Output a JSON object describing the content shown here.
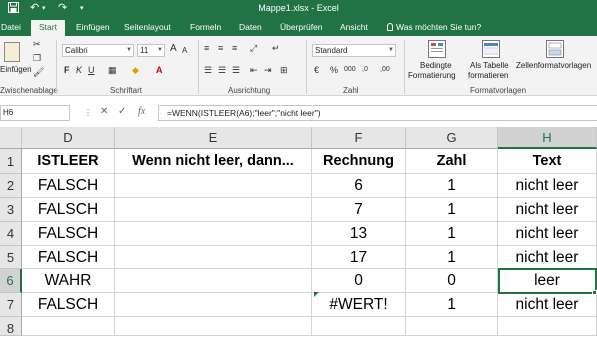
{
  "window": {
    "title": "Mappe1.xlsx - Excel",
    "save_icon": "save-icon",
    "undo_icon": "undo-icon",
    "redo_icon": "redo-icon",
    "qa_dropdown_icon": "dropdown-icon"
  },
  "ribbon_tabs": [
    "Datei",
    "Start",
    "Einfügen",
    "Seitenlayout",
    "Formeln",
    "Daten",
    "Überprüfen",
    "Ansicht"
  ],
  "active_tab": "Start",
  "tell_me": "Was möchten Sie tun?",
  "clipboard": {
    "paste_label": "Einfügen",
    "group_label": "Zwischenablage"
  },
  "font": {
    "name": "Calibri",
    "size": "11",
    "group_label": "Schriftart",
    "bold": "F",
    "italic": "K",
    "underline": "U",
    "grow": "A",
    "shrink": "A"
  },
  "alignment": {
    "group_label": "Ausrichtung"
  },
  "number": {
    "format": "Standard",
    "group_label": "Zahl",
    "currency_symbol": "€",
    "percent": "%",
    "thousands": "000",
    "decimals_add": ",0",
    "decimals_remove": ",00"
  },
  "styles": {
    "conditional_line1": "Bedingte",
    "conditional_line2": "Formatierung",
    "table_line1": "Als Tabelle",
    "table_line2": "formatieren",
    "cellstyles": "Zellenformatvorlagen",
    "group_label": "Formatvorlagen"
  },
  "formula_bar": {
    "name_box": "H6",
    "cancel": "✕",
    "enter": "✓",
    "fx": "fx",
    "formula": "=WENN(ISTLEER(A6);\"leer\";\"nicht leer\")"
  },
  "columns": [
    "D",
    "E",
    "F",
    "G",
    "H"
  ],
  "selected_column": "H",
  "rows": [
    {
      "num": "1",
      "cells": [
        "ISTLEER",
        "Wenn nicht leer, dann...",
        "Rechnung",
        "Zahl",
        "Text"
      ]
    },
    {
      "num": "2",
      "cells": [
        "FALSCH",
        "",
        "6",
        "1",
        "nicht leer"
      ]
    },
    {
      "num": "3",
      "cells": [
        "FALSCH",
        "",
        "7",
        "1",
        "nicht leer"
      ]
    },
    {
      "num": "4",
      "cells": [
        "FALSCH",
        "",
        "13",
        "1",
        "nicht leer"
      ]
    },
    {
      "num": "5",
      "cells": [
        "FALSCH",
        "",
        "17",
        "1",
        "nicht leer"
      ]
    },
    {
      "num": "6",
      "cells": [
        "WAHR",
        "",
        "0",
        "0",
        "leer"
      ]
    },
    {
      "num": "7",
      "cells": [
        "FALSCH",
        "",
        "#WERT!",
        "1",
        "nicht leer"
      ]
    },
    {
      "num": "8",
      "cells": [
        "",
        "",
        "",
        "",
        ""
      ]
    }
  ],
  "selected_row": "6",
  "colors": {
    "accent": "#217346",
    "ribbon_bg": "#f3f3f3",
    "header_bg": "#e6e6e6"
  }
}
